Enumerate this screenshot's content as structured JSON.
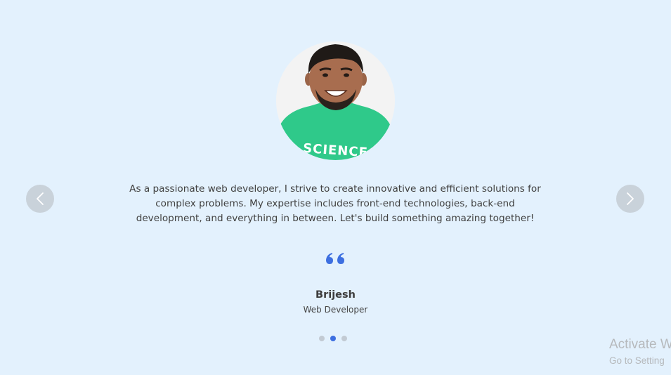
{
  "testimonial": {
    "text": "As a passionate web developer, I strive to create innovative and efficient solutions for complex problems. My expertise includes front-end technologies, back-end development, and everything in between. Let's build something amazing together!",
    "name": "Brijesh",
    "role": "Web Developer",
    "photo_shirt_text": "SCIENCE"
  },
  "carousel": {
    "prev_icon": "chevron-left-icon",
    "next_icon": "chevron-right-icon",
    "slide_count": 3,
    "active_slide": 2
  },
  "watermark": {
    "title": "Activate W",
    "subtitle": "Go to Setting"
  },
  "colors": {
    "background": "#e3f1fd",
    "accent": "#3d6fe0",
    "nav_button": "#c9d2da",
    "dot_inactive": "#c2cad3"
  }
}
